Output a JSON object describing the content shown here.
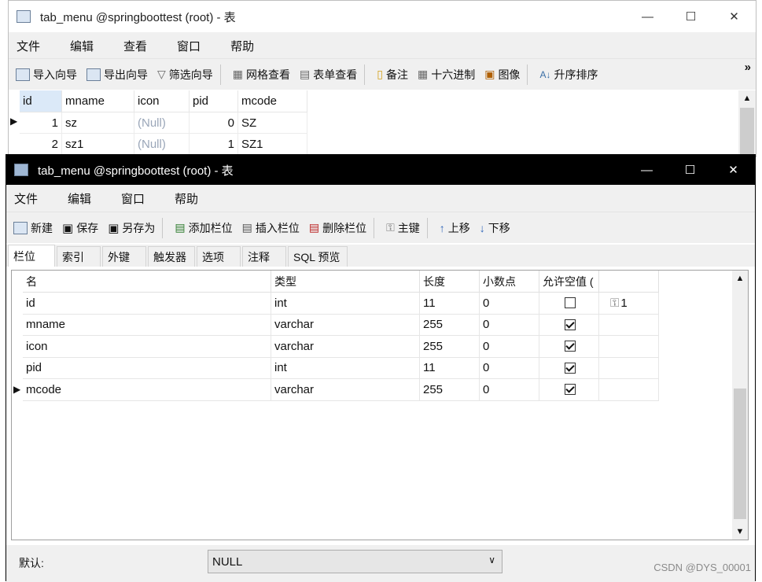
{
  "back_window": {
    "title": "tab_menu @springboottest (root) - 表",
    "menu": [
      "文件",
      "编辑",
      "查看",
      "窗口",
      "帮助"
    ],
    "toolbar": [
      "导入向导",
      "导出向导",
      "筛选向导",
      "网格查看",
      "表单查看",
      "备注",
      "十六进制",
      "图像",
      "升序排序"
    ],
    "overflow": "»",
    "columns": [
      "id",
      "mname",
      "icon",
      "pid",
      "mcode"
    ],
    "rows": [
      {
        "marker": "▶",
        "id": "1",
        "mname": "sz",
        "icon": "(Null)",
        "pid": "0",
        "mcode": "SZ"
      },
      {
        "marker": "",
        "id": "2",
        "mname": "sz1",
        "icon": "(Null)",
        "pid": "1",
        "mcode": "SZ1"
      }
    ]
  },
  "front_window": {
    "title": "tab_menu @springboottest (root) - 表",
    "menu": [
      "文件",
      "编辑",
      "窗口",
      "帮助"
    ],
    "toolbar": [
      "新建",
      "保存",
      "另存为",
      "添加栏位",
      "插入栏位",
      "删除栏位",
      "主键",
      "上移",
      "下移"
    ],
    "tabs": [
      "栏位",
      "索引",
      "外键",
      "触发器",
      "选项",
      "注释",
      "SQL 预览"
    ],
    "active_tab": "栏位",
    "field_columns": [
      "名",
      "类型",
      "长度",
      "小数点",
      "允许空值 (",
      ""
    ],
    "fields": [
      {
        "marker": "",
        "name": "id",
        "type": "int",
        "length": "11",
        "decimals": "0",
        "nullable": false,
        "key": "1"
      },
      {
        "marker": "",
        "name": "mname",
        "type": "varchar",
        "length": "255",
        "decimals": "0",
        "nullable": true,
        "key": ""
      },
      {
        "marker": "",
        "name": "icon",
        "type": "varchar",
        "length": "255",
        "decimals": "0",
        "nullable": true,
        "key": ""
      },
      {
        "marker": "",
        "name": "pid",
        "type": "int",
        "length": "11",
        "decimals": "0",
        "nullable": true,
        "key": ""
      },
      {
        "marker": "▶",
        "name": "mcode",
        "type": "varchar",
        "length": "255",
        "decimals": "0",
        "nullable": true,
        "key": ""
      }
    ],
    "default_label": "默认:",
    "default_value": "NULL"
  },
  "watermark": "CSDN @DYS_00001",
  "colors": {
    "null_text": "#9aa6b8",
    "title_active_bg": "#000000",
    "toolbar_bg": "#f0f0f0"
  }
}
